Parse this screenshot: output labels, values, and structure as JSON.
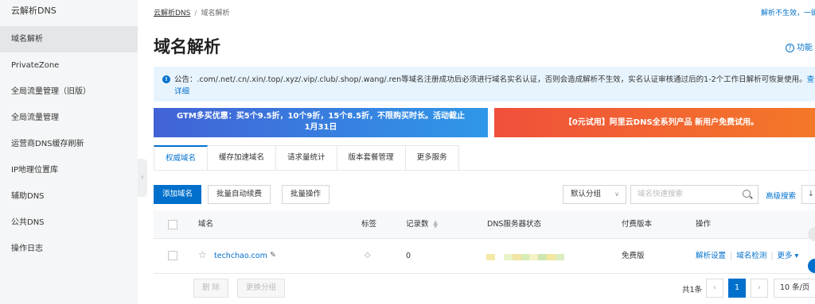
{
  "sidebar": {
    "title": "云解析DNS",
    "items": [
      {
        "label": "域名解析",
        "active": true
      },
      {
        "label": "PrivateZone"
      },
      {
        "label": "全局流量管理（旧版）"
      },
      {
        "label": "全局流量管理"
      },
      {
        "label": "运营商DNS缓存刷新"
      },
      {
        "label": "IP地理位置库"
      },
      {
        "label": "辅助DNS"
      },
      {
        "label": "公共DNS"
      },
      {
        "label": "操作日志"
      }
    ]
  },
  "breadcrumb": {
    "root": "云解析DNS",
    "separator": "/",
    "current": "域名解析"
  },
  "top_right_link": "解析不生效，一键",
  "page_title": "域名解析",
  "help_link": "功能",
  "notice": {
    "text": "公告：.com/.net/.cn/.xin/.top/.xyz/.vip/.club/.shop/.wang/.ren等域名注册成功后必须进行域名实名认证，否则会造成解析不生效，实名认证审核通过后的1-2个工作日解析可恢复使用。",
    "link": "查看详细"
  },
  "banners": {
    "left_line1": "GTM多买优惠：买5个9.5折，10个9折，15个8.5折，不限购买时长。活动截止",
    "left_line2": "1月31日",
    "right": "【0元试用】阿里云DNS全系列产品 新用户免费试用。"
  },
  "tabs": [
    "权威域名",
    "缓存加速域名",
    "请求量统计",
    "版本套餐管理",
    "更多服务"
  ],
  "toolbar": {
    "add": "添加域名",
    "batch_renew": "批量自动续费",
    "batch_op": "批量操作",
    "group_select": "默认分组",
    "search_placeholder": "域名快速搜索",
    "advanced_search": "高级搜索"
  },
  "table": {
    "headers": {
      "domain": "域名",
      "tags": "标签",
      "records": "记录数",
      "dns_status": "DNS服务器状态",
      "edition": "付费版本",
      "ops": "操作"
    },
    "rows": [
      {
        "domain": "techchao.com",
        "records": "0",
        "edition": "免费版",
        "op1": "解析设置",
        "op2": "域名检测",
        "op3": "更多"
      }
    ]
  },
  "footer": {
    "delete": "删 除",
    "change_group": "更换分组",
    "total": "共1条",
    "page": "1",
    "page_size": "10 条/页"
  },
  "colors": {
    "accent": "#0070cc",
    "sidebar_bg": "#f5f6f7",
    "notice_bg": "#e8f4fd"
  }
}
